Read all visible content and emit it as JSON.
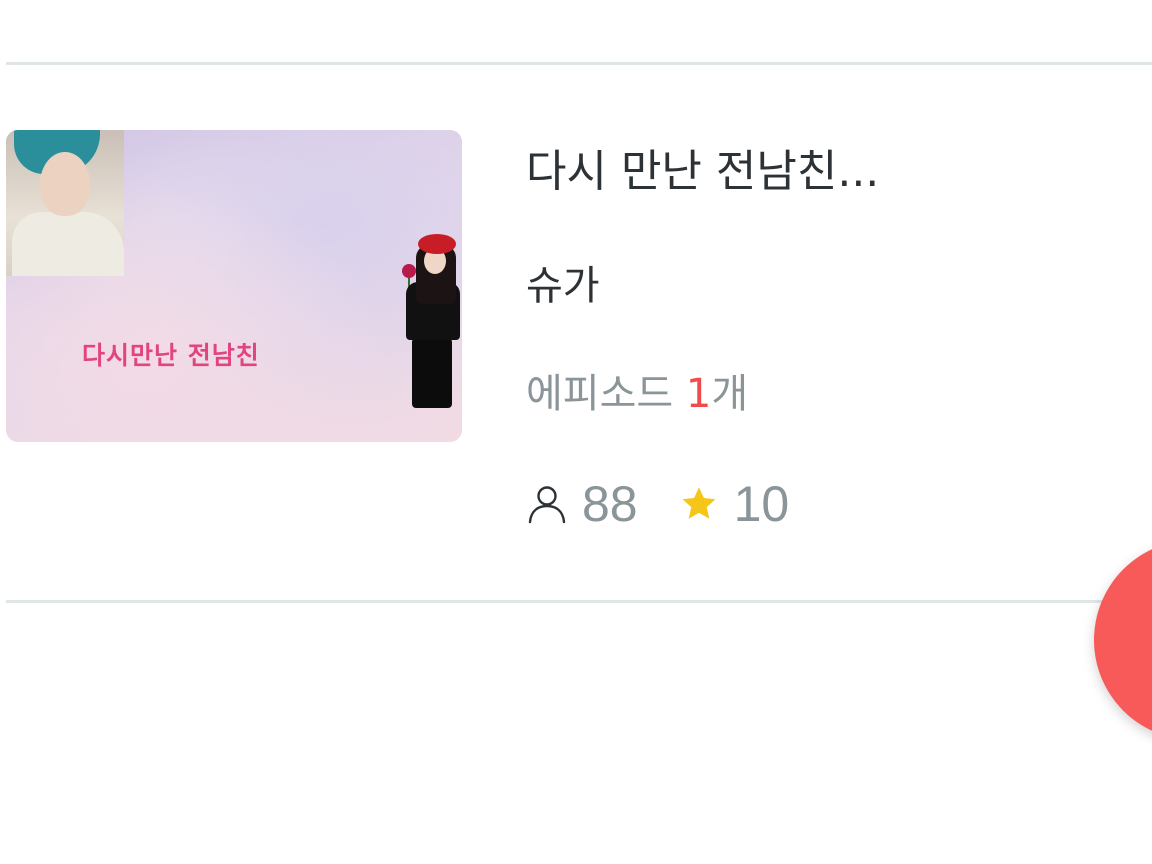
{
  "story": {
    "thumbnail_caption": "다시만난 전남친",
    "title": "다시 만난 전남친...",
    "author": "슈가",
    "episodes_prefix": "에피소드 ",
    "episodes_count": "1",
    "episodes_suffix": "개",
    "views": "88",
    "stars": "10"
  },
  "icons": {
    "views": "person-icon",
    "stars": "star-icon"
  },
  "colors": {
    "accent": "#ef4d4d",
    "fab": "#f75a58",
    "star": "#f5c518",
    "muted_text": "#8a9499",
    "primary_text": "#2d3236"
  }
}
